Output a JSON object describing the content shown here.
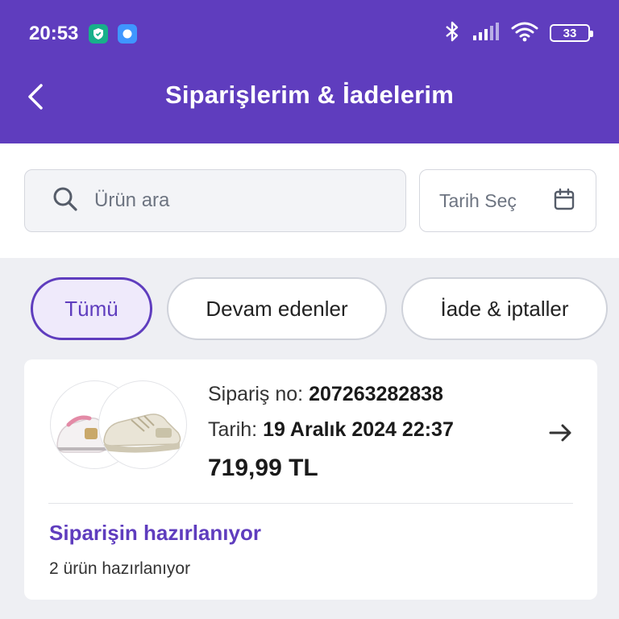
{
  "status_bar": {
    "time": "20:53",
    "battery": "33",
    "icons": [
      "shield-app-icon",
      "chat-app-icon",
      "bluetooth-icon",
      "signal-icon",
      "wifi-icon",
      "battery-icon"
    ]
  },
  "header": {
    "title": "Siparişlerim & İadelerim",
    "back_icon": "chevron-left-icon"
  },
  "search": {
    "placeholder": "Ürün ara",
    "date_label": "Tarih Seç"
  },
  "filters": [
    {
      "label": "Tümü",
      "selected": true
    },
    {
      "label": "Devam edenler",
      "selected": false
    },
    {
      "label": "İade & iptaller",
      "selected": false
    }
  ],
  "order": {
    "order_no_label": "Sipariş no:",
    "order_no": "207263282838",
    "date_label": "Tarih:",
    "date": "19 Aralık 2024 22:37",
    "price": "719,99 TL",
    "status": "Siparişin hazırlanıyor",
    "status_detail": "2 ürün hazırlanıyor"
  },
  "colors": {
    "brand": "#5f3dbe",
    "background": "#eeeff3"
  }
}
